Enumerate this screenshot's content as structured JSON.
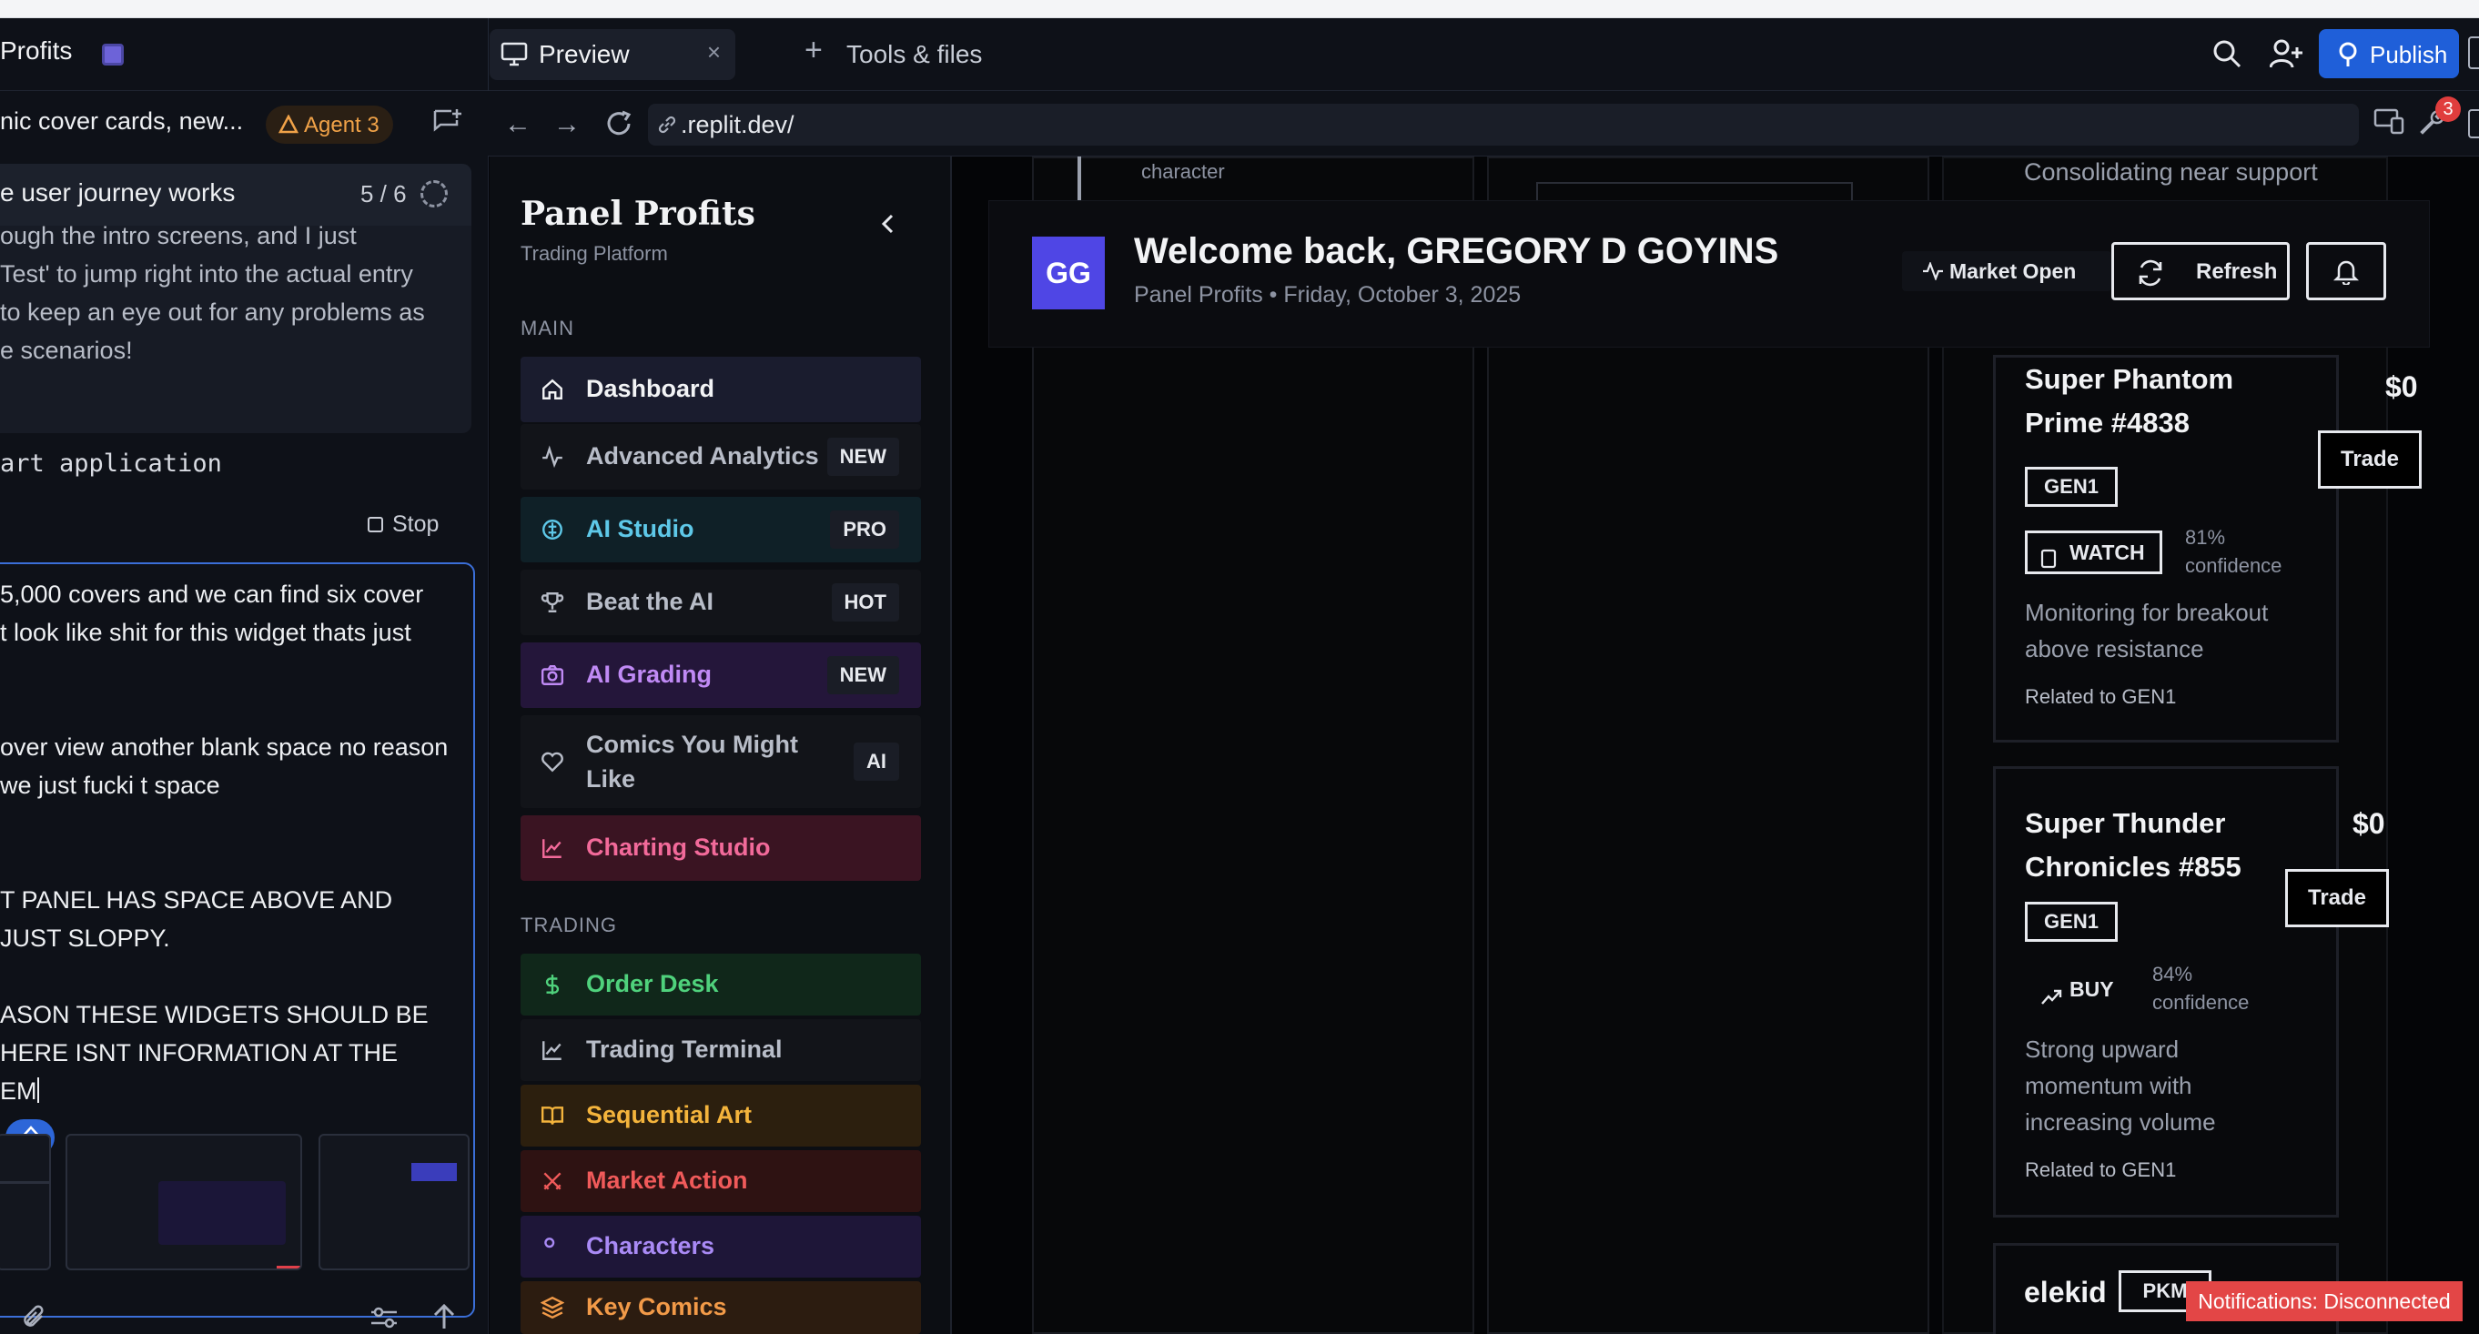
{
  "app": {
    "project_title": "Profits",
    "tabs": [
      {
        "label": "Preview",
        "active": true
      },
      {
        "label": "Tools & files"
      }
    ],
    "publish_label": "Publish"
  },
  "agent_panel": {
    "thread_title": "nic cover cards, new...",
    "agent_label": "Agent 3",
    "task": {
      "name": "e user journey works",
      "progress": "5 / 6"
    },
    "task_lines": [
      "ough the intro screens, and I just",
      "Test' to jump right into the actual entry",
      " to keep an eye out for any problems as",
      "e scenarios!"
    ],
    "checkpoint": "art application",
    "stop_label": "Stop",
    "composer_lines": [
      "5,000 covers and we can find six cover",
      "t look like shit for this widget thats just",
      "",
      "",
      "over view another blank space no reason",
      "we just fucki t space",
      "",
      "",
      "T PANEL HAS SPACE ABOVE AND",
      " JUST SLOPPY.",
      "",
      "ASON THESE WIDGETS SHOULD BE",
      "HERE ISNT INFORMATION AT THE",
      "EM"
    ]
  },
  "browser": {
    "url": ".replit.dev/",
    "badge_count": "3"
  },
  "sidebar": {
    "brand_title": "Panel Profits",
    "brand_subtitle": "Trading Platform",
    "main_label": "MAIN",
    "trading_label": "TRADING",
    "main_items": [
      {
        "label": "Dashboard",
        "badge": "",
        "color": "#f2f3f5",
        "bg": "#1a1c2e"
      },
      {
        "label": "Advanced Analytics",
        "badge": "NEW",
        "color": "#b8bdc8",
        "bg": "#121419"
      },
      {
        "label": "AI Studio",
        "badge": "PRO",
        "color": "#5ec8e8",
        "bg": "#0f2027"
      },
      {
        "label": "Beat the AI",
        "badge": "HOT",
        "color": "#b8bdc8",
        "bg": "#121419"
      },
      {
        "label": "AI Grading",
        "badge": "NEW",
        "color": "#c08af5",
        "bg": "#24163a"
      },
      {
        "label": "Comics You Might Like",
        "badge": "AI",
        "color": "#b8bdc8",
        "bg": "#121419"
      },
      {
        "label": "Charting Studio",
        "badge": "",
        "color": "#f26a9a",
        "bg": "#3a1422"
      }
    ],
    "trading_items": [
      {
        "label": "Order Desk",
        "color": "#4fd17c",
        "bg": "#10271a"
      },
      {
        "label": "Trading Terminal",
        "color": "#b8bdc8",
        "bg": "#121419"
      },
      {
        "label": "Sequential Art",
        "color": "#f4b43c",
        "bg": "#2c1f0e"
      },
      {
        "label": "Market Action",
        "color": "#f05a5a",
        "bg": "#2e1212"
      },
      {
        "label": "Characters",
        "color": "#a98af5",
        "bg": "#1e1638"
      },
      {
        "label": "Key Comics",
        "color": "#f29a48",
        "bg": "#2c1c10"
      }
    ]
  },
  "dashboard": {
    "avatar": "GG",
    "welcome": "Welcome back, GREGORY D GOYINS",
    "subtitle": "Panel Profits • Friday, October 3, 2025",
    "market_status": "Market Open",
    "refresh_label": "Refresh",
    "bg_text_character": "character",
    "bg_text_consolidating": "Consolidating near support",
    "signals": [
      {
        "name_line1": "Super Phantom",
        "name_line2": "Prime #4838",
        "price": "$0",
        "trade_label": "Trade",
        "tag": "GEN1",
        "action": "WATCH",
        "confidence_line1": "81%",
        "confidence_line2": "confidence",
        "desc_line1": "Monitoring for breakout",
        "desc_line2": "above resistance",
        "related": "Related to GEN1"
      },
      {
        "name_line1": "Super Thunder",
        "name_line2": "Chronicles #855",
        "price": "$0",
        "trade_label": "Trade",
        "tag": "GEN1",
        "action": "BUY",
        "confidence_line1": "84%",
        "confidence_line2": "confidence",
        "desc_line1": "Strong upward",
        "desc_line2": "momentum with",
        "desc_line3": "increasing volume",
        "related": "Related to GEN1"
      }
    ],
    "third_card": {
      "name": "elekid",
      "tag": "PKM"
    },
    "notification": "Notifications: Disconnected"
  }
}
